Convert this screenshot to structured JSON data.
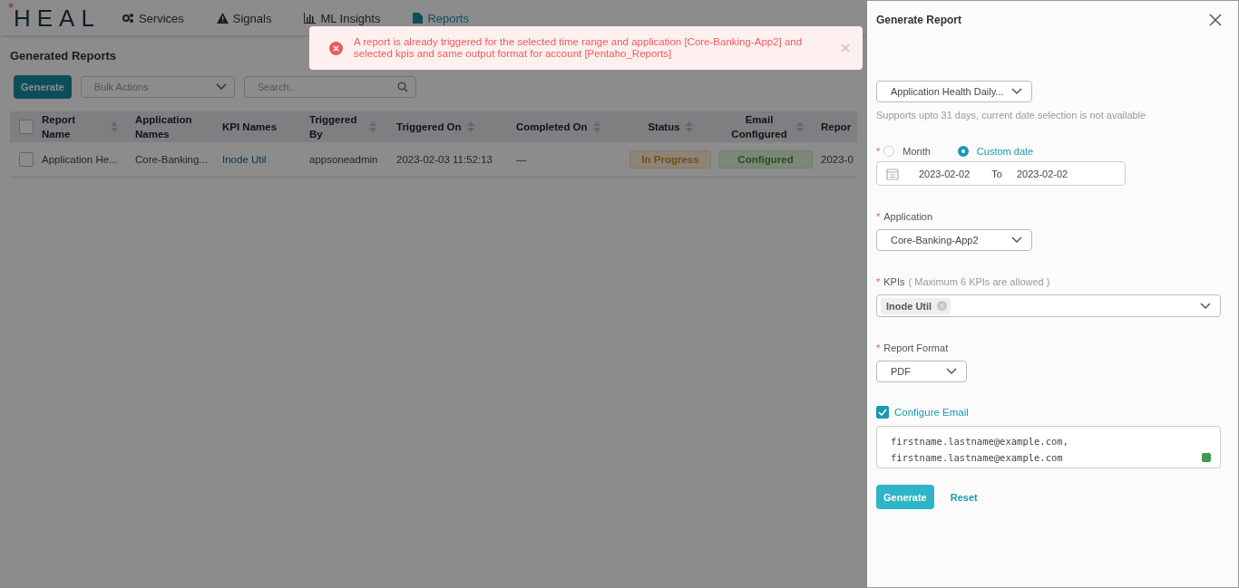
{
  "nav": {
    "logo_mark": "*",
    "logo": "HEAL",
    "items": [
      {
        "label": "Services",
        "selected": false
      },
      {
        "label": "Signals",
        "selected": false
      },
      {
        "label": "ML Insights",
        "selected": false
      },
      {
        "label": "Reports",
        "selected": true
      }
    ]
  },
  "page": {
    "title": "Generated Reports",
    "generate_button": "Generate",
    "bulk_actions": {
      "placeholder": "Bulk Actions"
    },
    "search": {
      "placeholder": "Search..."
    }
  },
  "table": {
    "select_all_checked": false,
    "columns": [
      {
        "label": "Report Name",
        "sortable": true
      },
      {
        "label": "Application Names",
        "sortable": false
      },
      {
        "label": "KPI Names",
        "sortable": false
      },
      {
        "label": "Triggered By",
        "sortable": true
      },
      {
        "label": "Triggered On",
        "sortable": true
      },
      {
        "label": "Completed On",
        "sortable": true
      },
      {
        "label": "Status",
        "sortable": true
      },
      {
        "label": "Email Configured",
        "sortable": true
      },
      {
        "label": "Repor",
        "sortable": false
      }
    ],
    "rows": [
      {
        "checked": false,
        "cells": [
          "Application He...",
          "Core-Banking...",
          "Inode Util",
          "appsoneadmin",
          "2023-02-03 11:52:13",
          "—"
        ],
        "status": {
          "label": "In Progress",
          "kind": "warning"
        },
        "email": {
          "label": "Configured",
          "kind": "success"
        },
        "column_9": "2023-0"
      }
    ]
  },
  "toast": {
    "kind": "error",
    "message": "A report is already triggered for the selected time range and application [Core-Banking-App2] and selected kpis and same output format for account [Pentaho_Reports]"
  },
  "panel": {
    "title": "Generate Report",
    "report_select": {
      "value": "Application Health Daily..."
    },
    "hint": "Supports upto 31 days, current date selection is not available",
    "date_required_mark": "*",
    "date_mode": [
      {
        "label": "Month",
        "selected": false
      },
      {
        "label": "Custom date",
        "selected": true
      }
    ],
    "date_from": "2023-02-02",
    "date_sep": "To",
    "date_to": "2023-02-02",
    "application": {
      "required_mark": "*",
      "label": "Application",
      "value": "Core-Banking-App2"
    },
    "kpis": {
      "required_mark": "*",
      "label": "KPIs",
      "note": "( Maximum 6 KPIs are allowed )",
      "tags": [
        "Inode Util"
      ]
    },
    "format": {
      "required_mark": "*",
      "label": "Report Format",
      "value": "PDF"
    },
    "configure_email": {
      "label": "Configure Email",
      "checked": true
    },
    "emails": "firstname.lastname@example.com,\nfirstname.lastname@example.com",
    "generate_button": "Generate",
    "reset_link": "Reset"
  }
}
